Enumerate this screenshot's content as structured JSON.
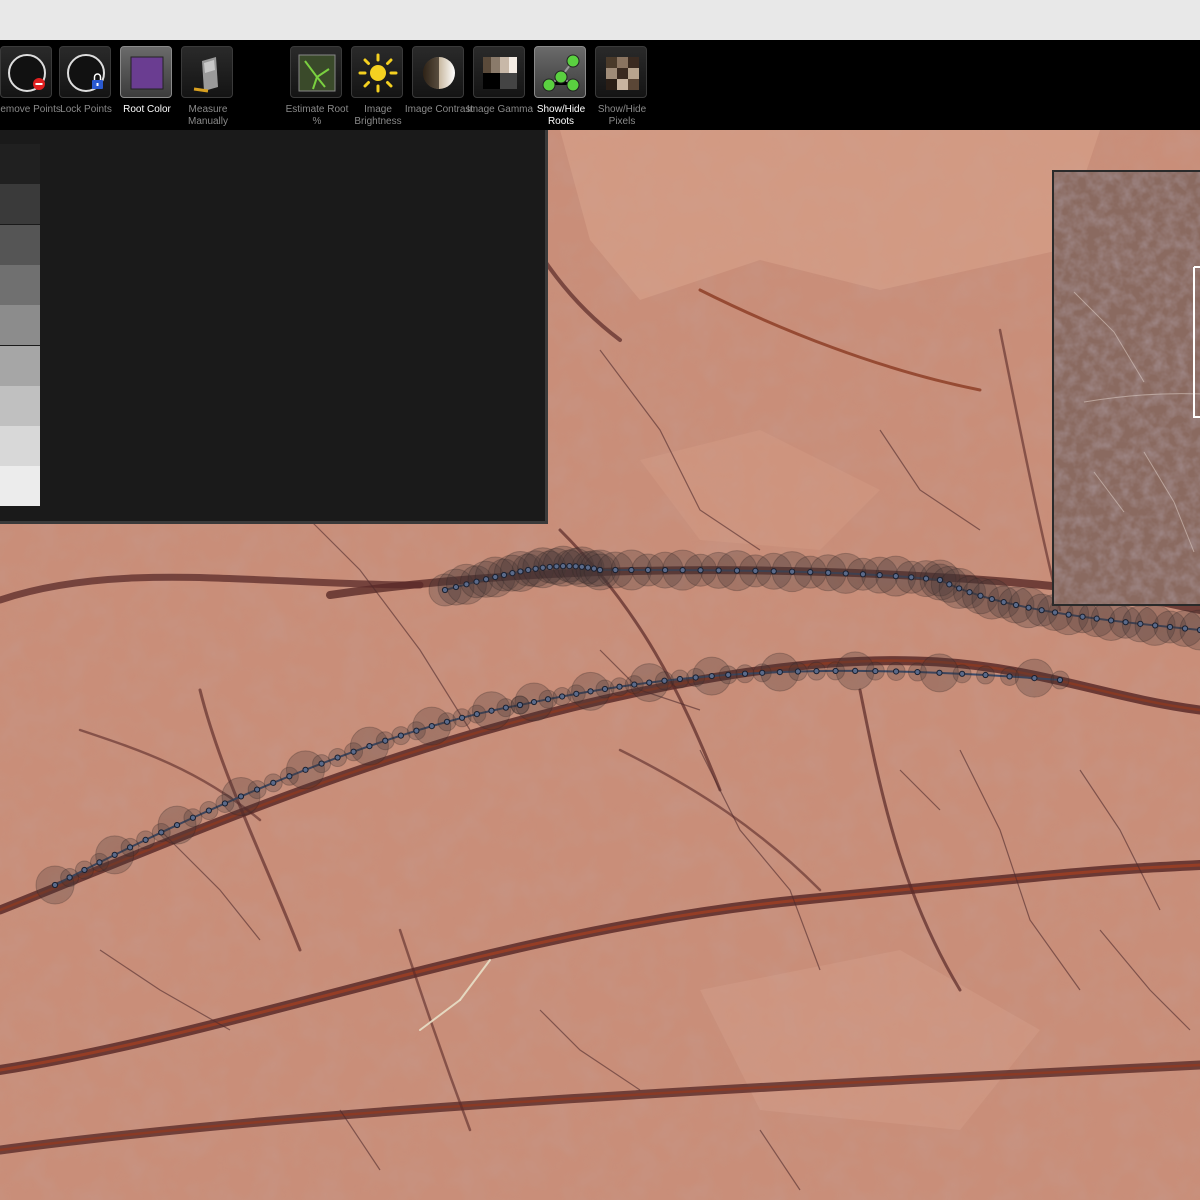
{
  "toolbar": {
    "tools": [
      {
        "id": "remove-points",
        "label": "Remove Points",
        "icon": "remove-points-icon",
        "active": false,
        "highlight": false
      },
      {
        "id": "lock-points",
        "label": "Lock Points",
        "icon": "lock-points-icon",
        "active": false,
        "highlight": false
      },
      {
        "id": "root-color",
        "label": "Root Color",
        "icon": "root-color-icon",
        "active": true,
        "highlight": true
      },
      {
        "id": "measure-manually",
        "label": "Measure Manually",
        "icon": "measure-manually-icon",
        "active": false,
        "highlight": false
      },
      {
        "id": "estimate-root",
        "label": "Estimate Root %",
        "icon": "estimate-root-icon",
        "active": false,
        "highlight": false
      },
      {
        "id": "image-brightness",
        "label": "Image Brightness",
        "icon": "sun-icon",
        "active": false,
        "highlight": false
      },
      {
        "id": "image-contrast",
        "label": "Image Contrast",
        "icon": "contrast-icon",
        "active": false,
        "highlight": false
      },
      {
        "id": "image-gamma",
        "label": "Image Gamma",
        "icon": "gamma-icon",
        "active": false,
        "highlight": false
      },
      {
        "id": "show-hide-roots",
        "label": "Show/Hide Roots",
        "icon": "roots-network-icon",
        "active": true,
        "highlight": true
      },
      {
        "id": "show-hide-pixels",
        "label": "Show/Hide Pixels",
        "icon": "pixels-icon",
        "active": false,
        "highlight": false
      }
    ]
  },
  "root_color": "#6a3d91",
  "palette": {
    "rows": [
      [
        "#2a0a18",
        "#25122a",
        "#141d30",
        "#0f1f2e",
        "#143130",
        "#0f2a20",
        "#102a12",
        "#172a10",
        "#2c2c10",
        "#2a1f14",
        "#2e1708",
        "#2a0a0c",
        "#202020"
      ],
      [
        "#420a25",
        "#361a45",
        "#1a2a4e",
        "#153348",
        "#1f4d4d",
        "#124030",
        "#155a1a",
        "#284c18",
        "#5c5c14",
        "#48301c",
        "#5a2808",
        "#560e10",
        "#3a3a3a"
      ],
      [
        "#6a0e3a",
        "#4c2c66",
        "#22366a",
        "#1c4e6e",
        "#2e7474",
        "#166044",
        "#1e8a24",
        "#367a24",
        "#8e8e1c",
        "#664430",
        "#8c3c0c",
        "#801a1c",
        "#555555"
      ],
      [
        "#8a1050",
        "#6a3890",
        "#2a4e96",
        "#2070a0",
        "#3aa0a0",
        "#1a8060",
        "#20ae2c",
        "#4a9a30",
        "#c4c026",
        "#825434",
        "#c4540e",
        "#b02222",
        "#707070"
      ],
      [
        "#b0186c",
        "#7e4cac",
        "#3660b4",
        "#2e90c8",
        "#4ec6c6",
        "#20a070",
        "#2ad040",
        "#5ab83c",
        "#eeec30",
        "#a06e48",
        "#f06818",
        "#d83030",
        "#8c8c8c"
      ],
      [
        "#c04890",
        "#9470c0",
        "#5a80c4",
        "#54a4d4",
        "#72d0d0",
        "#48b490",
        "#4cdc5e",
        "#7cc45c",
        "#f0ec5a",
        "#b48e70",
        "#f48844",
        "#e05858",
        "#a6a6a6"
      ],
      [
        "#cc74ae",
        "#ae98d0",
        "#84a0d2",
        "#80bcdc",
        "#98dcdc",
        "#78c8aa",
        "#7ae488",
        "#9ed280",
        "#f2ee84",
        "#c8aa94",
        "#f6a678",
        "#e88484",
        "#c0c0c0"
      ],
      [
        "#dca4cc",
        "#c8bce0",
        "#aebee0",
        "#aad2e6",
        "#bee8e8",
        "#a6dac8",
        "#a8eeb0",
        "#c0e2a8",
        "#f6f4ac",
        "#dac8b8",
        "#f8c4a4",
        "#f0b0b0",
        "#d8d8d8"
      ],
      [
        "#eed0e4",
        "#e4dcf0",
        "#d6dff0",
        "#d4e6f2",
        "#def4f4",
        "#d0ece4",
        "#d4f8d8",
        "#dcf0d4",
        "#fafad4",
        "#eae0d8",
        "#fce0d2",
        "#f8d8d8",
        "#ececec"
      ]
    ]
  },
  "preview_icon": "minimap-icon"
}
